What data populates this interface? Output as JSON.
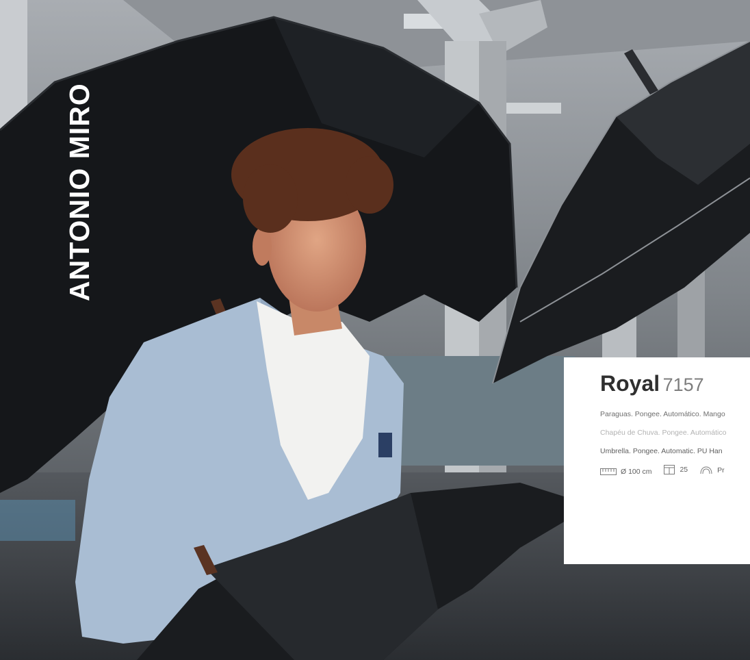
{
  "brand": "ANTONIO MIRO",
  "product": {
    "name": "Royal",
    "code": "7157",
    "descriptions": [
      "Paraguas. Pongee. Automático. Mango",
      "Chapéu de Chuva. Pongee. Automático",
      "Umbrella. Pongee. Automatic. PU Han"
    ],
    "specs": {
      "diameter": "Ø 100 cm",
      "box_quantity": "25",
      "print_label": "Pr"
    }
  },
  "icons": [
    "ruler-icon",
    "box-icon",
    "print-icon"
  ],
  "colors": {
    "card_bg": "#ffffff",
    "title": "#2f2f2f",
    "code": "#7d7d7d",
    "brand_text": "#ffffff"
  }
}
